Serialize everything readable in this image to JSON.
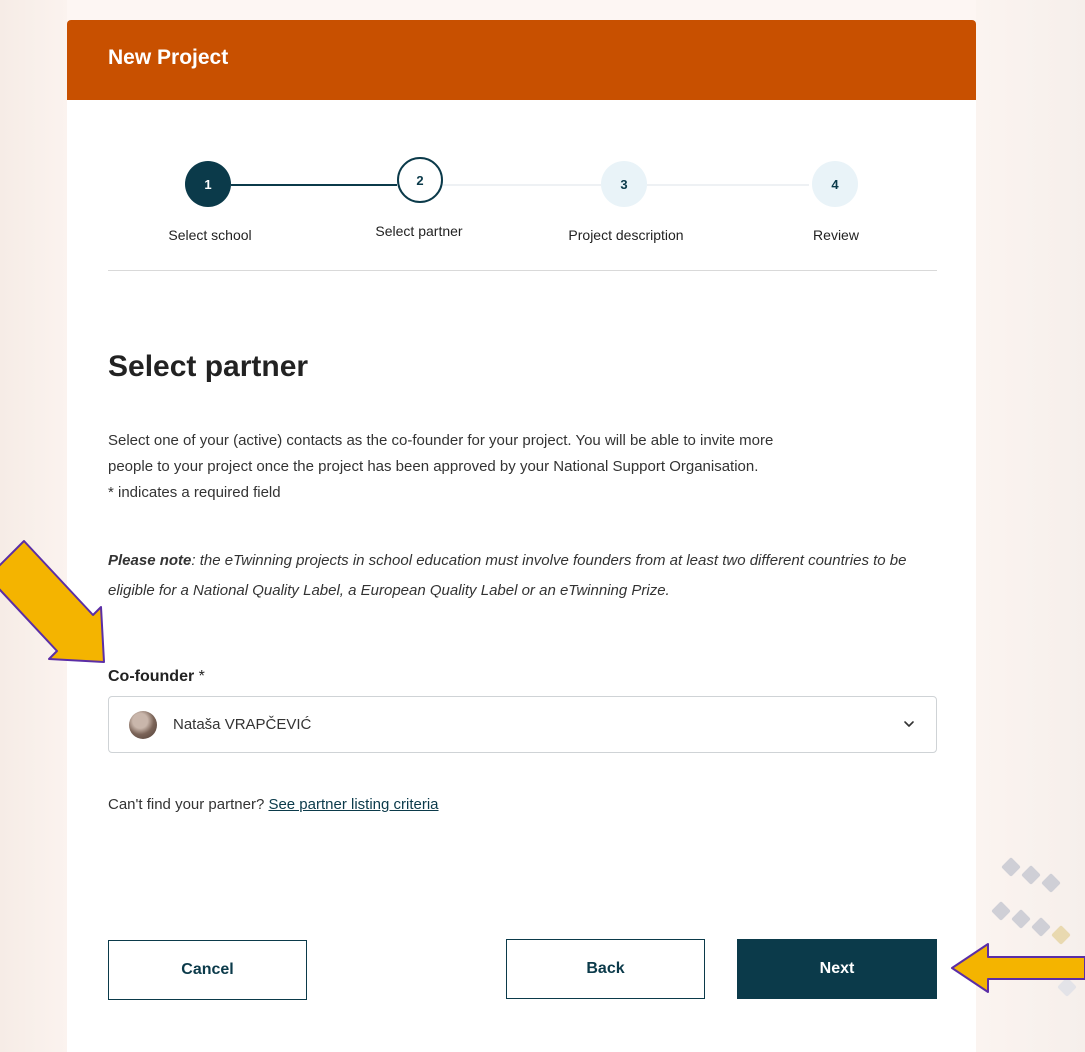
{
  "header": {
    "title": "New Project"
  },
  "stepper": {
    "steps": [
      {
        "number": "1",
        "label": "Select school",
        "state": "done"
      },
      {
        "number": "2",
        "label": "Select partner",
        "state": "active"
      },
      {
        "number": "3",
        "label": "Project description",
        "state": "todo"
      },
      {
        "number": "4",
        "label": "Review",
        "state": "todo"
      }
    ]
  },
  "section": {
    "title": "Select partner",
    "intro_line1": "Select one of your (active) contacts as the co-founder for your project. You will be able to invite more",
    "intro_line2": "people to your project once the project has been approved by your National Support Organisation.",
    "required_hint": "* indicates a required field",
    "note_bold": "Please note",
    "note_text": ": the eTwinning projects in school education must involve founders from at least two different countries to be eligible for a National Quality Label, a European Quality Label or an eTwinning Prize."
  },
  "cofounder": {
    "label": "Co-founder",
    "required_mark": " *",
    "selected_value": "Nataša VRAPČEVIĆ"
  },
  "help": {
    "text": "Can't find your partner? ",
    "link_label": "See partner listing criteria"
  },
  "buttons": {
    "cancel_label": "Cancel",
    "back_label": "Back",
    "next_label": "Next"
  },
  "colors": {
    "header_bg": "#c85000",
    "primary": "#0b3a4a",
    "annotation_arrow": "#f4b400",
    "annotation_outline": "#5b2ea6"
  }
}
